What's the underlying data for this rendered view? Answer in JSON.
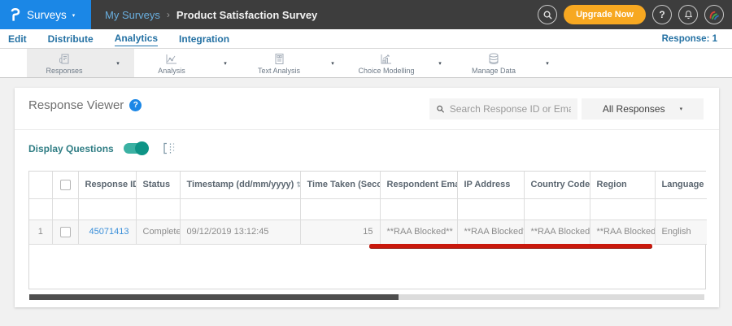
{
  "topbar": {
    "product_label": "Surveys",
    "breadcrumb": {
      "parent": "My Surveys",
      "separator": "›",
      "current": "Product Satisfaction Survey"
    },
    "upgrade_label": "Upgrade Now",
    "help_glyph": "?"
  },
  "tabs": {
    "items": [
      {
        "label": "Edit"
      },
      {
        "label": "Distribute"
      },
      {
        "label": "Analytics",
        "active": true
      },
      {
        "label": "Integration"
      }
    ],
    "response_count": "Response: 1"
  },
  "toolbar": {
    "items": [
      {
        "label": "Responses",
        "icon": "responses-icon",
        "active": true
      },
      {
        "label": "Analysis",
        "icon": "analysis-icon"
      },
      {
        "label": "Text Analysis",
        "icon": "text-analysis-icon"
      },
      {
        "label": "Choice Modelling",
        "icon": "choice-modelling-icon"
      },
      {
        "label": "Manage Data",
        "icon": "manage-data-icon"
      }
    ]
  },
  "viewer": {
    "title": "Response Viewer",
    "help_glyph": "?",
    "search_placeholder": "Search Response ID or Email",
    "filter_selected": "All Responses",
    "display_questions_label": "Display Questions",
    "display_questions_on": true
  },
  "table": {
    "headers": {
      "response_id": "Response ID",
      "status": "Status",
      "timestamp": "Timestamp (dd/mm/yyyy)",
      "time_taken": "Time Taken (Seconds)",
      "respondent_email": "Respondent Email",
      "ip_address": "IP Address",
      "country_code": "Country Code",
      "region": "Region",
      "language": "Language"
    },
    "rows": [
      {
        "index": "1",
        "response_id": "45071413",
        "status": "Completed",
        "timestamp": "09/12/2019 13:12:45",
        "time_taken": "15",
        "respondent_email": "**RAA Blocked**",
        "ip_address": "**RAA Blocked**",
        "country_code": "**RAA Blocked**",
        "region": "**RAA Blocked**",
        "language": "English"
      }
    ]
  },
  "glyphs": {
    "caret_down": "▾",
    "sort_desc": "▼",
    "sort_both": "⇅"
  },
  "colors": {
    "brand_blue": "#1b87e6",
    "topbar_bg": "#3d3d3d",
    "upgrade_orange": "#f7a821",
    "link_blue": "#3a8fd9",
    "toggle_teal": "#0e9486",
    "annotation_red": "#c9180c"
  }
}
